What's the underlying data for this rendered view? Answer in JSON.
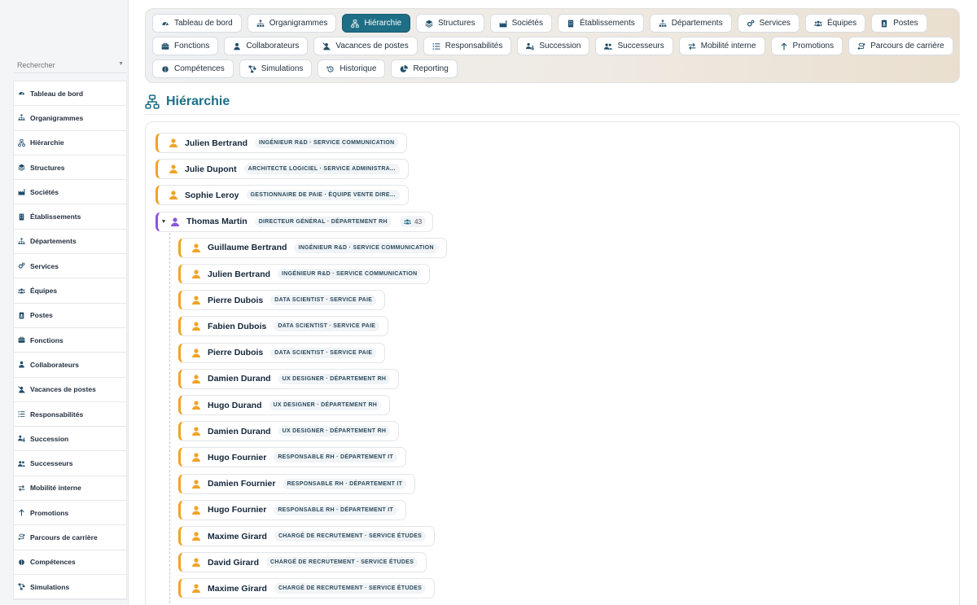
{
  "search": {
    "placeholder": "Rechercher"
  },
  "sidebar": {
    "items": [
      {
        "label": "Tableau de bord",
        "icon": "gauge-icon"
      },
      {
        "label": "Organigrammes",
        "icon": "sitemap-icon"
      },
      {
        "label": "Hiérarchie",
        "icon": "hierarchy-icon"
      },
      {
        "label": "Structures",
        "icon": "layers-icon"
      },
      {
        "label": "Sociétés",
        "icon": "industry-icon"
      },
      {
        "label": "Établissements",
        "icon": "building-icon"
      },
      {
        "label": "Départements",
        "icon": "sitemap-icon"
      },
      {
        "label": "Services",
        "icon": "cogs-icon"
      },
      {
        "label": "Équipes",
        "icon": "users-icon"
      },
      {
        "label": "Postes",
        "icon": "id-badge-icon"
      },
      {
        "label": "Fonctions",
        "icon": "briefcase-icon"
      },
      {
        "label": "Collaborateurs",
        "icon": "user-icon"
      },
      {
        "label": "Vacances de postes",
        "icon": "user-slash-icon"
      },
      {
        "label": "Responsabilités",
        "icon": "list-icon"
      },
      {
        "label": "Succession",
        "icon": "user-chart-icon"
      },
      {
        "label": "Successeurs",
        "icon": "user-friends-icon"
      },
      {
        "label": "Mobilité interne",
        "icon": "exchange-icon"
      },
      {
        "label": "Promotions",
        "icon": "arrow-up-icon"
      },
      {
        "label": "Parcours de carrière",
        "icon": "route-icon"
      },
      {
        "label": "Compétences",
        "icon": "brain-icon"
      },
      {
        "label": "Simulations",
        "icon": "project-diagram-icon"
      }
    ]
  },
  "tabs": [
    {
      "label": "Tableau de bord",
      "icon": "gauge-icon",
      "active": false
    },
    {
      "label": "Organigrammes",
      "icon": "sitemap-icon",
      "active": false
    },
    {
      "label": "Hiérarchie",
      "icon": "hierarchy-icon",
      "active": true
    },
    {
      "label": "Structures",
      "icon": "layers-icon",
      "active": false
    },
    {
      "label": "Sociétés",
      "icon": "industry-icon",
      "active": false
    },
    {
      "label": "Établissements",
      "icon": "building-icon",
      "active": false
    },
    {
      "label": "Départements",
      "icon": "sitemap-icon",
      "active": false
    },
    {
      "label": "Services",
      "icon": "cogs-icon",
      "active": false
    },
    {
      "label": "Équipes",
      "icon": "users-icon",
      "active": false
    },
    {
      "label": "Postes",
      "icon": "id-badge-icon",
      "active": false
    },
    {
      "label": "Fonctions",
      "icon": "briefcase-icon",
      "active": false
    },
    {
      "label": "Collaborateurs",
      "icon": "user-icon",
      "active": false
    },
    {
      "label": "Vacances de postes",
      "icon": "user-slash-icon",
      "active": false
    },
    {
      "label": "Responsabilités",
      "icon": "list-icon",
      "active": false
    },
    {
      "label": "Succession",
      "icon": "user-chart-icon",
      "active": false
    },
    {
      "label": "Successeurs",
      "icon": "user-friends-icon",
      "active": false
    },
    {
      "label": "Mobilité interne",
      "icon": "exchange-icon",
      "active": false
    },
    {
      "label": "Promotions",
      "icon": "arrow-up-icon",
      "active": false
    },
    {
      "label": "Parcours de carrière",
      "icon": "route-icon",
      "active": false
    },
    {
      "label": "Compétences",
      "icon": "brain-icon",
      "active": false
    },
    {
      "label": "Simulations",
      "icon": "project-diagram-icon",
      "active": false
    },
    {
      "label": "Historique",
      "icon": "history-icon",
      "active": false
    },
    {
      "label": "Reporting",
      "icon": "pie-chart-icon",
      "active": false
    }
  ],
  "page": {
    "title": "Hiérarchie",
    "icon": "hierarchy-icon"
  },
  "colors": {
    "accent": "#1e6f86",
    "employee_bar": "#f0a326",
    "manager_bar": "#8a57d6"
  },
  "tree": {
    "roots": [
      {
        "name": "Julien Bertrand",
        "role": "INGÉNIEUR R&D · SERVICE COMMUNICATION"
      },
      {
        "name": "Julie Dupont",
        "role": "ARCHITECTE LOGICIEL · SERVICE ADMINISTRA..."
      },
      {
        "name": "Sophie Leroy",
        "role": "GESTIONNAIRE DE PAIE · ÉQUIPE VENTE DIRE..."
      }
    ],
    "manager": {
      "name": "Thomas Martin",
      "role": "DIRECTEUR GÉNÉRAL · DÉPARTEMENT RH",
      "count": "43",
      "expanded": true
    },
    "children": [
      {
        "name": "Guillaume Bertrand",
        "role": "INGÉNIEUR R&D · SERVICE COMMUNICATION"
      },
      {
        "name": "Julien Bertrand",
        "role": "INGÉNIEUR R&D · SERVICE COMMUNICATION"
      },
      {
        "name": "Pierre Dubois",
        "role": "DATA SCIENTIST · SERVICE PAIE"
      },
      {
        "name": "Fabien Dubois",
        "role": "DATA SCIENTIST · SERVICE PAIE"
      },
      {
        "name": "Pierre Dubois",
        "role": "DATA SCIENTIST · SERVICE PAIE"
      },
      {
        "name": "Damien Durand",
        "role": "UX DESIGNER · DÉPARTEMENT RH"
      },
      {
        "name": "Hugo Durand",
        "role": "UX DESIGNER · DÉPARTEMENT RH"
      },
      {
        "name": "Damien Durand",
        "role": "UX DESIGNER · DÉPARTEMENT RH"
      },
      {
        "name": "Hugo Fournier",
        "role": "RESPONSABLE RH · DÉPARTEMENT IT"
      },
      {
        "name": "Damien Fournier",
        "role": "RESPONSABLE RH · DÉPARTEMENT IT"
      },
      {
        "name": "Hugo Fournier",
        "role": "RESPONSABLE RH · DÉPARTEMENT IT"
      },
      {
        "name": "Maxime Girard",
        "role": "CHARGÉ DE RECRUTEMENT · SERVICE ÉTUDES"
      },
      {
        "name": "David Girard",
        "role": "CHARGÉ DE RECRUTEMENT · SERVICE ÉTUDES"
      },
      {
        "name": "Maxime Girard",
        "role": "CHARGÉ DE RECRUTEMENT · SERVICE ÉTUDES"
      }
    ]
  }
}
